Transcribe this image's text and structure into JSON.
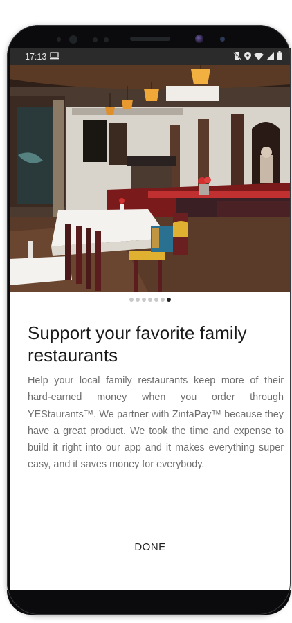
{
  "status_bar": {
    "time": "17:13",
    "icons": [
      "screenshot-icon",
      "mute-icon",
      "location-icon",
      "wifi-icon",
      "signal-icon",
      "battery-icon"
    ]
  },
  "hero": {
    "image": "restaurant-interior-photo"
  },
  "pager": {
    "total": 7,
    "active": 7
  },
  "onboarding": {
    "title": "Support your favorite family restaurants",
    "body": "Help your local family restaurants keep more of their hard-earned money when you order through YEStaurants™. We partner with ZintaPay™ because they have a great product. We took the time and expense to build it right into our app and it makes everything super easy, and it saves money for everybody.",
    "done_label": "DONE"
  },
  "colors": {
    "bezel": "#0b0b0d",
    "status_bar": "#2b2b2b",
    "title_text": "#1a1a1a",
    "body_text": "#6f6f6f",
    "dot_active": "#222222",
    "dot_inactive": "#c9c9c9"
  }
}
